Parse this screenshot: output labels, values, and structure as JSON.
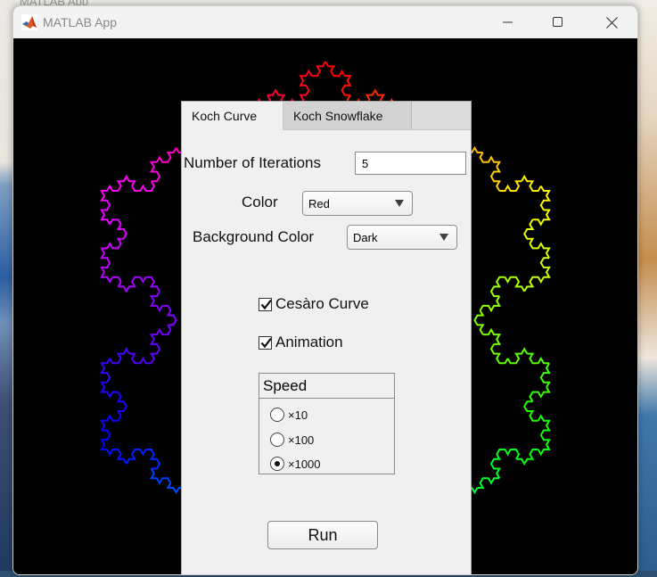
{
  "desktop": {
    "ghost_title": "MATLAB App"
  },
  "window": {
    "title": "MATLAB App",
    "icons": {
      "app": "matlab-icon",
      "minimize": "minimize-icon",
      "maximize": "maximize-icon",
      "close": "close-icon"
    }
  },
  "fractal": {
    "type": "koch-curve-rainbow",
    "background": "#000000"
  },
  "tabs": [
    {
      "label": "Koch Curve",
      "selected": true
    },
    {
      "label": "Koch Snowflake",
      "selected": false
    }
  ],
  "form": {
    "iterations_label": "Number of Iterations",
    "iterations_value": "5",
    "color_label": "Color",
    "color_value": "Red",
    "bgcolor_label": "Background Color",
    "bgcolor_value": "Dark",
    "cesaro_label": "Cesàro Curve",
    "cesaro_checked": true,
    "animation_label": "Animation",
    "animation_checked": true,
    "speed_title": "Speed",
    "speed_options": [
      {
        "label": "×10",
        "selected": false
      },
      {
        "label": "×100",
        "selected": false
      },
      {
        "label": "×1000",
        "selected": true
      }
    ],
    "run_label": "Run"
  },
  "colors": {
    "panel_bg": "#f0f0f0",
    "tab_inactive": "#d3d3d3",
    "canvas_bg": "#000000"
  }
}
